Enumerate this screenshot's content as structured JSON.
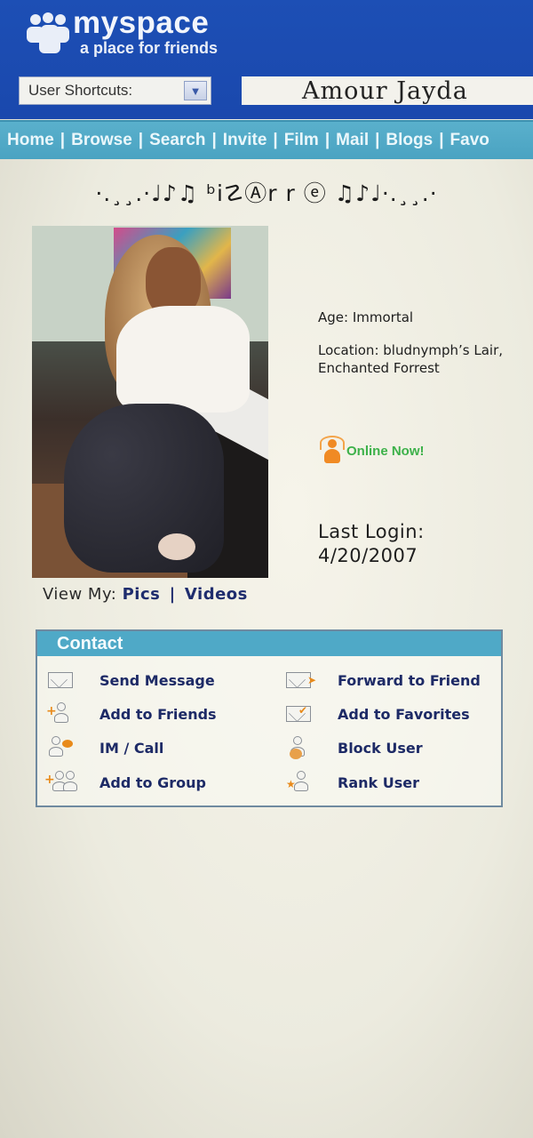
{
  "header": {
    "logo_word": "myspace",
    "logo_tagline": "a place for friends",
    "shortcuts_label": "User Shortcuts:",
    "profile_name": "Amour  Jayda"
  },
  "nav": {
    "items": [
      "Home",
      "Browse",
      "Search",
      "Invite",
      "Film",
      "Mail",
      "Blogs",
      "Favo"
    ],
    "separator": "|"
  },
  "banner": "·.¸¸.·♩♪♫ ᵇi☡Ⓐr r ⓔ ♫♪♩·.¸¸.·",
  "profile": {
    "age": "Age: Immortal",
    "location": "Location: bludnymph’s Lair, Enchanted Forrest",
    "online_status": "Online Now!",
    "last_login_label": "Last Login:",
    "last_login_date": "4/20/2007"
  },
  "view_my": {
    "label": "View My:",
    "pics": "Pics",
    "separator": "|",
    "videos": "Videos"
  },
  "contact": {
    "title": "Contact",
    "actions": [
      {
        "label": "Send Message",
        "icon": "envelope-icon"
      },
      {
        "label": "Forward to Friend",
        "icon": "forward-envelope-icon"
      },
      {
        "label": "Add to Friends",
        "icon": "add-friend-icon"
      },
      {
        "label": "Add to Favorites",
        "icon": "add-favorite-icon"
      },
      {
        "label": "IM / Call",
        "icon": "im-call-icon"
      },
      {
        "label": "Block User",
        "icon": "block-user-icon"
      },
      {
        "label": "Add to Group",
        "icon": "add-group-icon"
      },
      {
        "label": "Rank User",
        "icon": "rank-user-icon"
      }
    ]
  },
  "colors": {
    "header_blue": "#1d4fb5",
    "nav_teal": "#4fa9c7",
    "online_green": "#3db14a",
    "link_navy": "#1d2a66",
    "icon_orange": "#e88a1a"
  }
}
